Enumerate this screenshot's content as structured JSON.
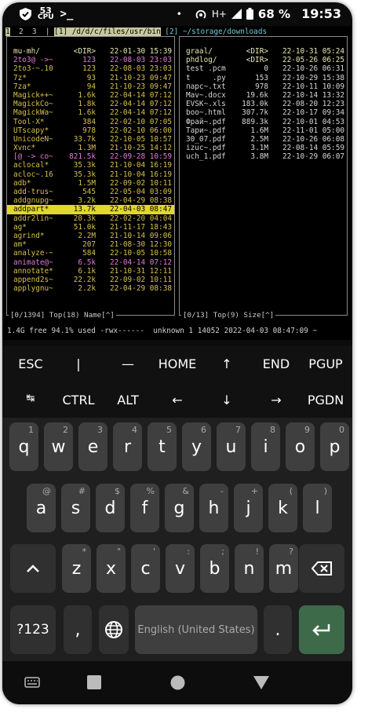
{
  "status_bar": {
    "cpu_value": "53",
    "cpu_label": "CPU",
    "prompt_icon": "terminal-icon",
    "dot": "•",
    "network": "H+",
    "battery": "68 %",
    "time": "19:53"
  },
  "tabs": {
    "nums": [
      "1",
      "2",
      "3"
    ],
    "sep": "|",
    "left_path": "[1] /d/d/c/files/usr/bin",
    "right_path": "[2] ~/storage/downloads"
  },
  "left_pane": {
    "files": [
      {
        "name": "mu-mh/",
        "size": "<DIR>",
        "date": "22-01-30 15:39",
        "kind": "dir"
      },
      {
        "name": "2to3@ ->~",
        "size": "123",
        "date": "22-08-03 23:03",
        "kind": "link"
      },
      {
        "name": "2to3-~.10",
        "size": "123",
        "date": "22-08-03 23:03",
        "kind": "exe"
      },
      {
        "name": "7z*",
        "size": "93",
        "date": "21-10-23 09:47",
        "kind": "exe"
      },
      {
        "name": "7za*",
        "size": "94",
        "date": "21-10-23 09:47",
        "kind": "exe"
      },
      {
        "name": "Magick++~",
        "size": "1.6k",
        "date": "22-04-14 07:12",
        "kind": "exe"
      },
      {
        "name": "MagickCo~",
        "size": "1.8k",
        "date": "22-04-14 07:12",
        "kind": "exe"
      },
      {
        "name": "MagickWa~",
        "size": "1.6k",
        "date": "22-04-14 07:12",
        "kind": "exe"
      },
      {
        "name": "Tool-X*",
        "size": "384",
        "date": "22-02-10 07:05",
        "kind": "exe"
      },
      {
        "name": "UTscapy*",
        "size": "978",
        "date": "22-02-10 06:00",
        "kind": "exe"
      },
      {
        "name": "UnicodeN~",
        "size": "33.7k",
        "date": "22-10-05 10:57",
        "kind": "exe"
      },
      {
        "name": "Xvnc*",
        "size": "1.3M",
        "date": "21-10-25 14:12",
        "kind": "exe"
      },
      {
        "name": "[@ -> co~",
        "size": "821.5k",
        "date": "22-09-28 10:59",
        "kind": "link"
      },
      {
        "name": "aclocal*",
        "size": "35.3k",
        "date": "21-10-04 16:19",
        "kind": "exe"
      },
      {
        "name": "acloc~.16",
        "size": "35.3k",
        "date": "21-10-04 16:19",
        "kind": "exe"
      },
      {
        "name": "adb*",
        "size": "1.5M",
        "date": "22-09-02 10:11",
        "kind": "exe"
      },
      {
        "name": "add-trus~",
        "size": "545",
        "date": "22-05-04 03:09",
        "kind": "exe"
      },
      {
        "name": "addgnupg~",
        "size": "3.2k",
        "date": "22-04-29 08:38",
        "kind": "exe"
      },
      {
        "name": "addpart*",
        "size": "13.7k",
        "date": "22-04-03 08:47",
        "kind": "sel"
      },
      {
        "name": "addr2lin~",
        "size": "20.3k",
        "date": "22-02-20 04:04",
        "kind": "exe"
      },
      {
        "name": "ag*",
        "size": "51.0k",
        "date": "21-11-17 18:43",
        "kind": "exe"
      },
      {
        "name": "agrind*",
        "size": "2.2M",
        "date": "21-10-14 09:06",
        "kind": "exe"
      },
      {
        "name": "am*",
        "size": "207",
        "date": "21-08-30 12:30",
        "kind": "exe"
      },
      {
        "name": "analyze-~",
        "size": "584",
        "date": "22-10-05 10:58",
        "kind": "exe"
      },
      {
        "name": "animate@~",
        "size": "6.5k",
        "date": "22-04-14 07:12",
        "kind": "link"
      },
      {
        "name": "annotate*",
        "size": "6.1k",
        "date": "21-10-31 12:11",
        "kind": "exe"
      },
      {
        "name": "append2s~",
        "size": "22.2k",
        "date": "22-09-02 10:11",
        "kind": "exe"
      },
      {
        "name": "applygnu~",
        "size": "2.2k",
        "date": "22-04-29 08:38",
        "kind": "exe"
      }
    ],
    "footer": "[0/1394] Top(18) Name[^]"
  },
  "right_pane": {
    "files": [
      {
        "name": "graal/",
        "size": "<DIR>",
        "date": "22-10-31 05:24",
        "kind": "dir"
      },
      {
        "name": "phdlog/",
        "size": "<DIR>",
        "date": "22-05-26 06:25",
        "kind": "dir"
      },
      {
        "name": "test .pcm",
        "size": "0",
        "date": "22-10-26 06:31",
        "kind": "file"
      },
      {
        "name": "t     .py",
        "size": "153",
        "date": "22-10-29 15:38",
        "kind": "file"
      },
      {
        "name": "парс~.txt",
        "size": "978",
        "date": "22-10-11 10:09",
        "kind": "file"
      },
      {
        "name": "Mav~.docx",
        "size": "19.6k",
        "date": "22-10-14 13:32",
        "kind": "file"
      },
      {
        "name": "EVSK~.xls",
        "size": "183.0k",
        "date": "22-08-20 12:23",
        "kind": "file"
      },
      {
        "name": "boo~.html",
        "size": "307.7k",
        "date": "22-10-17 09:34",
        "kind": "file"
      },
      {
        "name": "Фрай~.pdf",
        "size": "889.3k",
        "date": "22-10-01 04:53",
        "kind": "file"
      },
      {
        "name": "Тари~.pdf",
        "size": "1.6M",
        "date": "22-11-01 05:00",
        "kind": "file"
      },
      {
        "name": "30_07.pdf",
        "size": "2.5M",
        "date": "22-10-26 06:08",
        "kind": "file"
      },
      {
        "name": "izuc~.pdf",
        "size": "3.1M",
        "date": "22-08-14 05:59",
        "kind": "file"
      },
      {
        "name": "uch_1.pdf",
        "size": "3.8M",
        "date": "22-10-29 06:07",
        "kind": "file"
      }
    ],
    "footer": "[0/13] Top(9) Size[^]"
  },
  "command_line": "1.4G free 94.1% used -rwx------  unknown 1 14052 2022-04-03 08:47:09 ~",
  "extra_keys": {
    "row1": [
      "ESC",
      "|",
      "—",
      "HOME",
      "↑",
      "END",
      "PGUP"
    ],
    "row2": [
      "↹",
      "CTRL",
      "ALT",
      "←",
      "↓",
      "→",
      "PGDN"
    ]
  },
  "keyboard": {
    "row1": [
      {
        "k": "q",
        "h": "1"
      },
      {
        "k": "w",
        "h": "2"
      },
      {
        "k": "e",
        "h": "3"
      },
      {
        "k": "r",
        "h": "4"
      },
      {
        "k": "t",
        "h": "5"
      },
      {
        "k": "y",
        "h": "6"
      },
      {
        "k": "u",
        "h": "7"
      },
      {
        "k": "i",
        "h": "8"
      },
      {
        "k": "o",
        "h": "9"
      },
      {
        "k": "p",
        "h": "0"
      }
    ],
    "row2": [
      {
        "k": "a",
        "h": "@"
      },
      {
        "k": "s",
        "h": "#"
      },
      {
        "k": "d",
        "h": "$"
      },
      {
        "k": "f",
        "h": "%"
      },
      {
        "k": "g",
        "h": "&"
      },
      {
        "k": "h",
        "h": "-"
      },
      {
        "k": "j",
        "h": "+"
      },
      {
        "k": "k",
        "h": "("
      },
      {
        "k": "l",
        "h": ")"
      }
    ],
    "row3": [
      {
        "k": "z",
        "h": "*"
      },
      {
        "k": "x",
        "h": "\""
      },
      {
        "k": "c",
        "h": "'"
      },
      {
        "k": "v",
        "h": ":"
      },
      {
        "k": "b",
        "h": ";"
      },
      {
        "k": "n",
        "h": "!"
      },
      {
        "k": "m",
        "h": "?"
      }
    ],
    "symbols_label": "?123",
    "comma": ",",
    "space_label": "English (United States)",
    "period": ".",
    "shift_icon": "shift-icon",
    "backspace_icon": "backspace-icon",
    "enter_icon": "enter-icon",
    "globe_icon": "globe-icon"
  }
}
